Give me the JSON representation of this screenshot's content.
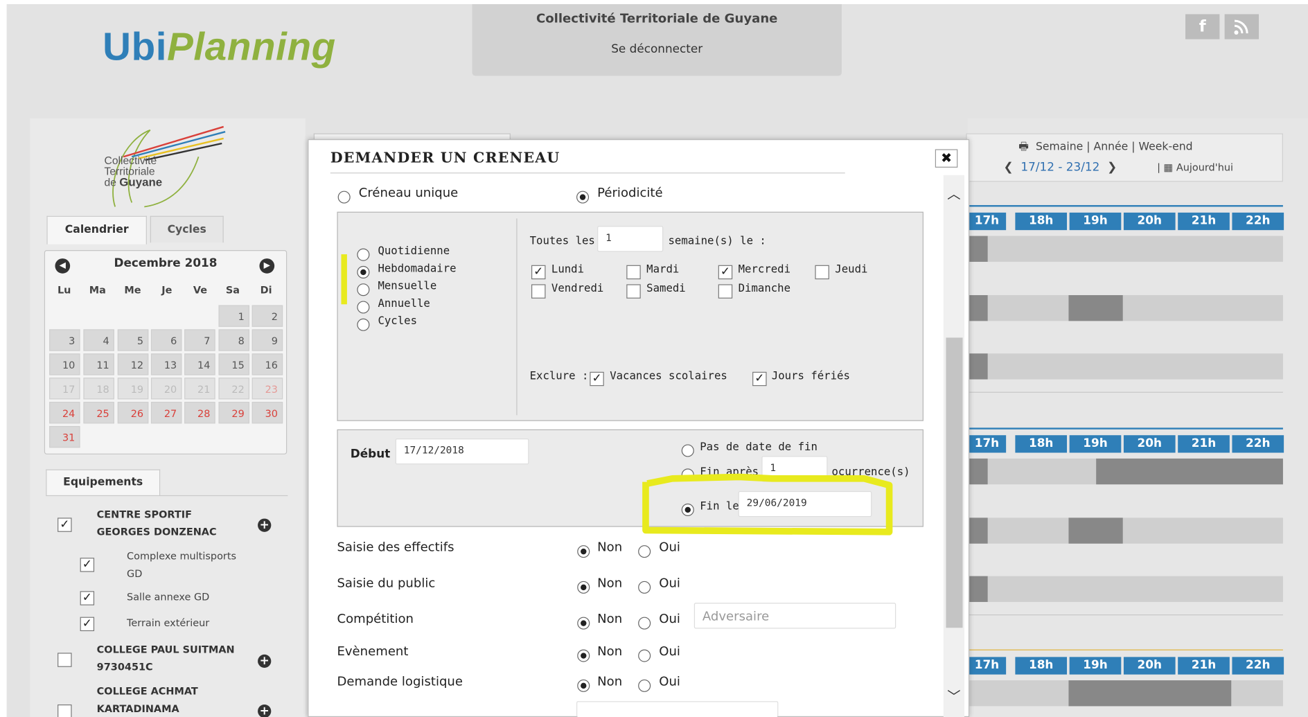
{
  "header": {
    "logo_ubi": "Ubi",
    "logo_planning": "Planning",
    "org_name": "Collectivité Territoriale de Guyane",
    "logout": "Se déconnecter",
    "social": {
      "facebook": "f",
      "rss": "⌇"
    }
  },
  "sidebar": {
    "org_logo_line1": "Collectivité",
    "org_logo_line2": "Territoriale",
    "org_logo_line3_prefix": "de",
    "org_logo_line3": "Guyane",
    "tabs": [
      {
        "label": "Calendrier"
      },
      {
        "label": "Cycles"
      }
    ],
    "calendar": {
      "title": "Decembre 2018",
      "dows": [
        "Lu",
        "Ma",
        "Me",
        "Je",
        "Ve",
        "Sa",
        "Di"
      ],
      "weeks": [
        [
          "",
          "",
          "",
          "",
          "",
          "1",
          "2"
        ],
        [
          "3",
          "4",
          "5",
          "6",
          "7",
          "8",
          "9"
        ],
        [
          "10",
          "11",
          "12",
          "13",
          "14",
          "15",
          "16"
        ],
        [
          "17",
          "18",
          "19",
          "20",
          "21",
          "22",
          "23"
        ],
        [
          "24",
          "25",
          "26",
          "27",
          "28",
          "29",
          "30"
        ],
        [
          "31",
          "",
          "",
          "",
          "",
          "",
          ""
        ]
      ]
    },
    "equipements_tab": "Equipements",
    "equipements": [
      {
        "line1": "CENTRE SPORTIF",
        "line2": "GEORGES DONZENAC",
        "checked": true
      },
      {
        "sub1": "Complexe multisports",
        "sub2": "GD",
        "checked": true
      },
      {
        "sub": "Salle annexe GD",
        "checked": true
      },
      {
        "sub": "Terrain extérieur",
        "checked": true
      },
      {
        "line1": "COLLEGE PAUL SUITMAN",
        "line2": "9730451C",
        "checked": false
      },
      {
        "line1": "COLLEGE ACHMAT",
        "line2": "KARTADINAMA",
        "checked": false
      }
    ]
  },
  "schedule": {
    "view_semaine": "Semaine",
    "view_annee": "Année",
    "view_weekend": "Week-end",
    "range": "17/12 - 23/12",
    "today": "Aujourd'hui",
    "hours": [
      "17h",
      "18h",
      "19h",
      "20h",
      "21h",
      "22h"
    ]
  },
  "modal": {
    "title": "DEMANDER UN CRENEAU",
    "close": "✖",
    "type_unique": "Créneau unique",
    "type_periodicite": "Périodicité",
    "frequencies": [
      "Quotidienne",
      "Hebdomadaire",
      "Mensuelle",
      "Annuelle",
      "Cycles"
    ],
    "toutes_les": "Toutes les",
    "interval_value": "1",
    "semaines_le": "semaine(s) le :",
    "days": [
      {
        "label": "Lundi",
        "checked": true
      },
      {
        "label": "Mardi",
        "checked": false
      },
      {
        "label": "Mercredi",
        "checked": true
      },
      {
        "label": "Jeudi",
        "checked": false
      },
      {
        "label": "Vendredi",
        "checked": false
      },
      {
        "label": "Samedi",
        "checked": false
      },
      {
        "label": "Dimanche",
        "checked": false
      }
    ],
    "exclure": "Exclure :",
    "exclude_vacances": "Vacances scolaires",
    "exclude_feries": "Jours fériés",
    "debut_label": "Début",
    "debut_value": "17/12/2018",
    "end_none": "Pas de date de fin",
    "end_after": "Fin après",
    "end_after_value": "1",
    "occurrences": "ocurrence(s)",
    "end_on": "Fin le",
    "end_on_value": "29/06/2019",
    "non": "Non",
    "oui": "Oui",
    "rows": {
      "effectifs": "Saisie des effectifs",
      "public": "Saisie du public",
      "competition": "Compétition",
      "evenement": "Evènement",
      "logistique": "Demande logistique"
    },
    "adversaire_placeholder": "Adversaire"
  }
}
